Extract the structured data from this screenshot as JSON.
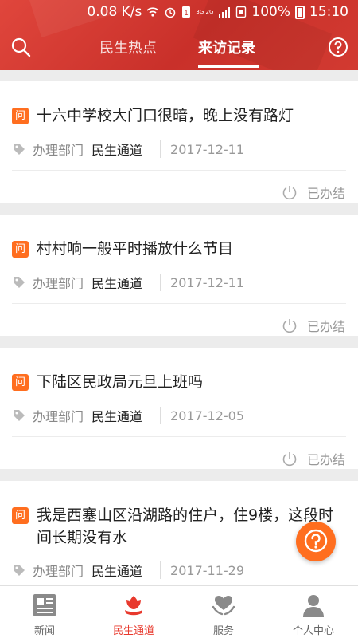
{
  "status_bar": {
    "speed": "0.08 K/s",
    "network": "3G 2G",
    "battery": "100%",
    "time": "15:10"
  },
  "header": {
    "tabs": [
      {
        "label": "民生热点",
        "active": false
      },
      {
        "label": "来访记录",
        "active": true
      }
    ],
    "search_icon": "search-icon",
    "help_icon": "help-icon"
  },
  "records": [
    {
      "badge": "问",
      "title": "十六中学校大门口很暗，晚上没有路灯",
      "dept_label": "办理部门",
      "dept": "民生通道",
      "date": "2017-12-11",
      "status": "已办结"
    },
    {
      "badge": "问",
      "title": "村村响一般平时播放什么节目",
      "dept_label": "办理部门",
      "dept": "民生通道",
      "date": "2017-12-11",
      "status": "已办结"
    },
    {
      "badge": "问",
      "title": "下陆区民政局元旦上班吗",
      "dept_label": "办理部门",
      "dept": "民生通道",
      "date": "2017-12-05",
      "status": "已办结"
    },
    {
      "badge": "问",
      "title": "我是西塞山区沿湖路的住户，住9楼，这段时间长期没有水",
      "dept_label": "办理部门",
      "dept": "民生通道",
      "date": "2017-11-29",
      "status": ""
    }
  ],
  "bottom_nav": [
    {
      "label": "新闻",
      "icon": "news-icon",
      "active": false
    },
    {
      "label": "民生通道",
      "icon": "tulip-icon",
      "active": true
    },
    {
      "label": "服务",
      "icon": "heart-hands-icon",
      "active": false
    },
    {
      "label": "个人中心",
      "icon": "person-icon",
      "active": false
    }
  ],
  "colors": {
    "header_red": "#d23a31",
    "accent_orange": "#ff6e1f",
    "active_red": "#e8392d"
  }
}
